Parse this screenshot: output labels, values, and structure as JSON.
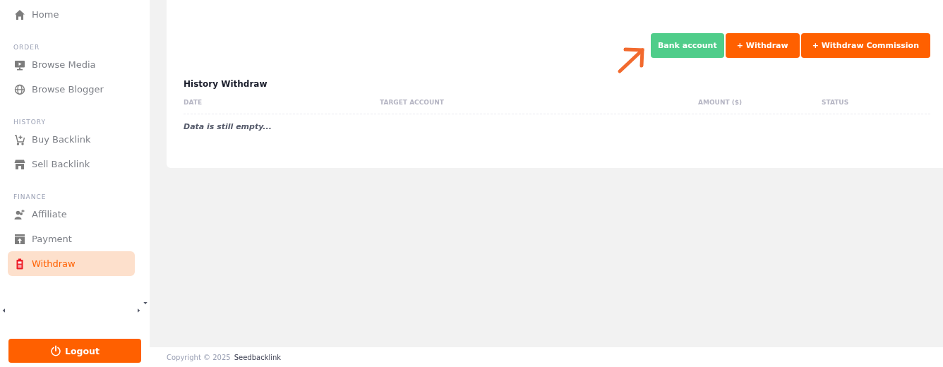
{
  "sidebar": {
    "items": [
      {
        "kind": "item",
        "label": "Home",
        "selected": false
      },
      {
        "kind": "header",
        "label": "ORDER"
      },
      {
        "kind": "item",
        "label": "Browse Media",
        "selected": false
      },
      {
        "kind": "item",
        "label": "Browse Blogger",
        "selected": false
      },
      {
        "kind": "header",
        "label": "HISTORY"
      },
      {
        "kind": "item",
        "label": "Buy Backlink",
        "selected": false
      },
      {
        "kind": "item",
        "label": "Sell Backlink",
        "selected": false
      },
      {
        "kind": "header",
        "label": "FINANCE"
      },
      {
        "kind": "item",
        "label": "Affiliate",
        "selected": false
      },
      {
        "kind": "item",
        "label": "Payment",
        "selected": false
      },
      {
        "kind": "item",
        "label": "Withdraw",
        "selected": true
      }
    ],
    "logout": "Logout"
  },
  "actions": [
    {
      "label": "Bank account",
      "kind": "secondary"
    },
    {
      "label": "+ Withdraw",
      "kind": "primary"
    },
    {
      "label": "+ Withdraw Commission",
      "kind": "primary"
    }
  ],
  "history": {
    "title": "History Withdraw",
    "columns": [
      "DATE",
      "TARGET ACCOUNT",
      "AMOUNT ($)",
      "STATUS"
    ],
    "empty": "Data is still empty..."
  },
  "footer": {
    "copyright": "Copyright © 2025",
    "brand": "Seedbacklink"
  }
}
